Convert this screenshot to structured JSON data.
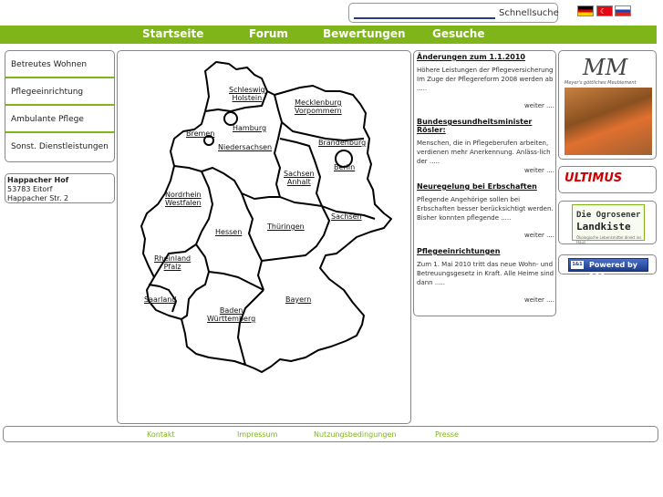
{
  "header": {
    "search_label": "Schnellsuche",
    "flags": [
      "flag-germany-icon",
      "flag-turkey-icon",
      "flag-russia-icon"
    ]
  },
  "nav": {
    "items": [
      "Startseite",
      "Forum",
      "Bewertungen",
      "Gesuche"
    ]
  },
  "sidebar": {
    "items": [
      "Betreutes Wohnen",
      "Pflegeeinrichtung",
      "Ambulante Pflege",
      "Sonst. Dienstleistungen"
    ]
  },
  "address": {
    "name": "Happacher Hof",
    "city": "53783 Eitorf",
    "street": "Happacher Str. 2"
  },
  "map": {
    "states": [
      {
        "line1": "Schleswig",
        "line2": "Holstein"
      },
      {
        "line1": "Mecklenburg",
        "line2": "Vorpommern"
      },
      {
        "line1": "Hamburg",
        "line2": ""
      },
      {
        "line1": "Bremen",
        "line2": ""
      },
      {
        "line1": "Brandenburg",
        "line2": ""
      },
      {
        "line1": "Niedersachsen",
        "line2": ""
      },
      {
        "line1": "Berlin",
        "line2": ""
      },
      {
        "line1": "Sachsen",
        "line2": "Anhalt"
      },
      {
        "line1": "Nordrhein",
        "line2": "Westfalen"
      },
      {
        "line1": "Sachsen",
        "line2": ""
      },
      {
        "line1": "Thüringen",
        "line2": ""
      },
      {
        "line1": "Hessen",
        "line2": ""
      },
      {
        "line1": "Rheinland",
        "line2": "Pfalz"
      },
      {
        "line1": "Saarland",
        "line2": ""
      },
      {
        "line1": "Bayern",
        "line2": ""
      },
      {
        "line1": "Baden",
        "line2": "Württemberg"
      }
    ]
  },
  "news": {
    "items": [
      {
        "title": "Änderungen zum 1.1.2010",
        "text": "Höhere Leistungen der Pflegeversicherung Im Zuge der Pflegereform 2008 werden ab .....",
        "more": "weiter ...."
      },
      {
        "title": "Bundesgesundheitsminister Rösler:",
        "text": "Menschen, die in Pflegeberufen arbeiten, verdienen mehr Anerkennung. Anläss-lich der .....",
        "more": "weiter ...."
      },
      {
        "title": "Neuregelung bei Erbschaften",
        "text": "Pflegende Angehörige sollen bei Erbschaften besser berücksichtigt werden. Bisher konnten pflegende .....",
        "more": "weiter ...."
      },
      {
        "title": "Pflegeeinrichtungen",
        "text": "Zum 1. Mai 2010 tritt das neue Wohn- und Betreuungsgesetz in Kraft. Alle Heime sind dann .....",
        "more": "weiter ...."
      }
    ]
  },
  "ads": {
    "meyer_logo": "MM",
    "meyer_sub": "Meyer's göttliches Meublement",
    "ultimus": "ULTIMUS",
    "landkiste_line1": "Die Ogrosener",
    "landkiste_line2": "Landkiste",
    "landkiste_line3": "Ökologische Lebensmittel direkt ins Haus",
    "oneandone_logo": "1&1",
    "oneandone_label": "Powered by 1&1"
  },
  "footer": {
    "items": [
      "Kontakt",
      "Impressum",
      "Nutzungsbedingungen",
      "Presse"
    ]
  },
  "colors": {
    "accent": "#7fb519"
  }
}
